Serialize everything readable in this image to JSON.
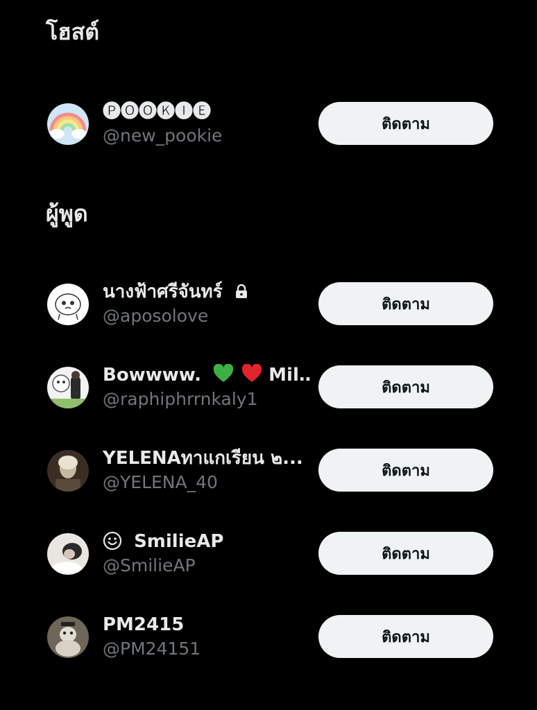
{
  "host_section": {
    "title": "โฮสต์",
    "users": [
      {
        "name": "🅟🅞🅞🅚🅘🅔",
        "handle": "@new_pookie",
        "button_label": "ติดตาม",
        "avatar_icon": "rainbow-avatar-icon"
      }
    ]
  },
  "speakers_section": {
    "title": "ผู้พูด",
    "users": [
      {
        "name": "นางฟ้าศรีจันทร์",
        "handle": "@aposolove",
        "button_label": "ติดตาม",
        "avatar_icon": "cartoon-avatar-icon",
        "protected": true
      },
      {
        "name": "Bowwww.",
        "name_suffix": "Mil…",
        "handle": "@raphiphrrnkaly1",
        "button_label": "ติดตาม",
        "avatar_icon": "photo-avatar-icon",
        "heart_colors": [
          "#3cb043",
          "#e0242c"
        ]
      },
      {
        "name": "YELENAทาแกเรียน ๒...",
        "handle": "@YELENA_40",
        "button_label": "ติดตาม",
        "avatar_icon": "photo-avatar-icon"
      },
      {
        "name": "SmilieAP",
        "handle": "@SmilieAP",
        "button_label": "ติดตาม",
        "avatar_icon": "photo-avatar-icon",
        "prefix_icon": "smiley-icon"
      },
      {
        "name": "PM2415",
        "handle": "@PM24151",
        "button_label": "ติดตาม",
        "avatar_icon": "photo-avatar-icon"
      }
    ]
  },
  "colors": {
    "background": "#000000",
    "primary_text": "#e7e9ea",
    "secondary_text": "#71767b",
    "button_bg": "#eff3f4",
    "button_text": "#0f1419"
  }
}
